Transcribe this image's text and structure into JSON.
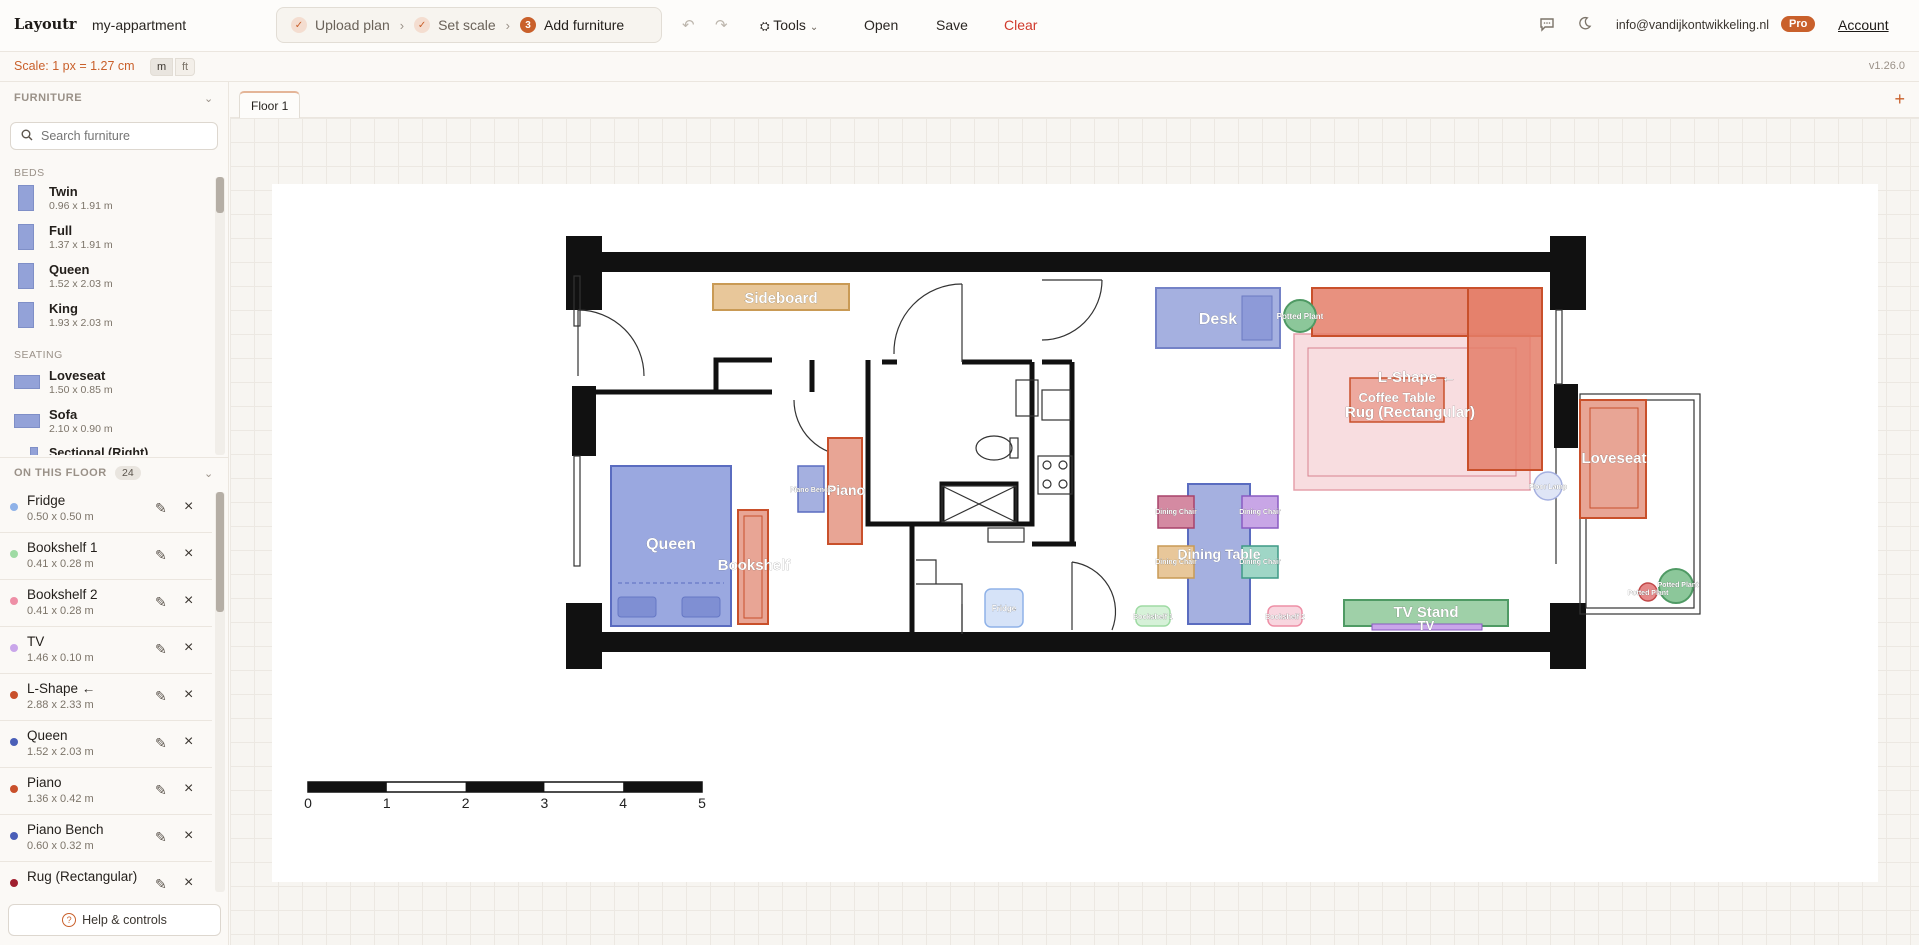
{
  "app": {
    "logo": "Layoutr",
    "project": "my-appartment"
  },
  "steps": [
    {
      "label": "Upload plan",
      "state": "done"
    },
    {
      "label": "Set scale",
      "state": "done"
    },
    {
      "label": "Add furniture",
      "state": "active",
      "number": "3"
    }
  ],
  "toolbar": {
    "tools": "Tools",
    "open": "Open",
    "save": "Save",
    "clear": "Clear"
  },
  "user": {
    "email": "info@vandijkontwikkeling.nl",
    "plan": "Pro",
    "account": "Account"
  },
  "scale": {
    "text": "Scale: 1 px = 1.27 cm",
    "unit_m": "m",
    "unit_ft": "ft",
    "version": "v1.26.0"
  },
  "furniture": {
    "header": "FURNITURE",
    "search_placeholder": "Search furniture",
    "categories": [
      {
        "name": "BEDS",
        "items": [
          {
            "name": "Twin",
            "dims": "0.96 x 1.91 m"
          },
          {
            "name": "Full",
            "dims": "1.37 x 1.91 m"
          },
          {
            "name": "Queen",
            "dims": "1.52 x 2.03 m"
          },
          {
            "name": "King",
            "dims": "1.93 x 2.03 m"
          }
        ]
      },
      {
        "name": "SEATING",
        "items": [
          {
            "name": "Loveseat",
            "dims": "1.50 x 0.85 m"
          },
          {
            "name": "Sofa",
            "dims": "2.10 x 0.90 m"
          },
          {
            "name": "Sectional (Right)",
            "dims": ""
          }
        ]
      }
    ]
  },
  "floor": {
    "header": "ON THIS FLOOR",
    "count": "24",
    "items": [
      {
        "name": "Fridge",
        "dims": "0.50 x 0.50 m",
        "color": "#8fb2e8"
      },
      {
        "name": "Bookshelf 1",
        "dims": "0.41 x 0.28 m",
        "color": "#9fdba4"
      },
      {
        "name": "Bookshelf 2",
        "dims": "0.41 x 0.28 m",
        "color": "#ee8fa6"
      },
      {
        "name": "TV",
        "dims": "1.46 x 0.10 m",
        "color": "#c9a6ea"
      },
      {
        "name": "L-Shape ←",
        "dims": "2.88 x 2.33 m",
        "color": "#c9502b"
      },
      {
        "name": "Queen",
        "dims": "1.52 x 2.03 m",
        "color": "#4a5fb8"
      },
      {
        "name": "Piano",
        "dims": "1.36 x 0.42 m",
        "color": "#c9502b"
      },
      {
        "name": "Piano Bench",
        "dims": "0.60 x 0.32 m",
        "color": "#4a5fb8"
      },
      {
        "name": "Rug (Rectangular)",
        "dims": "",
        "color": "#a01f2f"
      }
    ]
  },
  "help": "Help & controls",
  "tabs": [
    {
      "label": "Floor 1"
    }
  ],
  "plan": {
    "labels": {
      "sideboard": "Sideboard",
      "desk": "Desk",
      "potted_plant": "Potted Plant",
      "lshape": "L-Shape ←",
      "coffee_table": "Coffee Table",
      "rug": "Rug (Rectangular)",
      "loveseat": "Loveseat",
      "floor_lamp": "Floor Lamp",
      "queen": "Queen",
      "bookshelf": "Bookshelf",
      "piano": "Piano",
      "piano_bench": "Piano Bench",
      "dining_table": "Dining Table",
      "dining_chair": "Dining Chair",
      "fridge": "Fridge",
      "bookshelf1": "Bookshelf 1",
      "bookshelf2": "Bookshelf 2",
      "tv_stand": "TV Stand",
      "tv": "TV"
    },
    "scale_ticks": [
      "0",
      "1",
      "2",
      "3",
      "4",
      "5"
    ]
  },
  "colors": {
    "accent": "#c9602b",
    "danger": "#d03a2c"
  }
}
